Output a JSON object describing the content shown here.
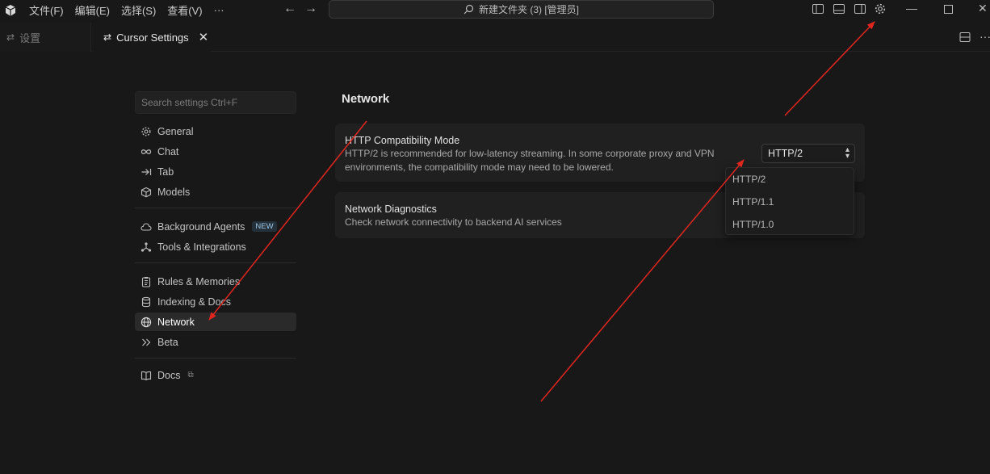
{
  "titlebar": {
    "menu": [
      "文件(F)",
      "编辑(E)",
      "选择(S)",
      "查看(V)",
      "···"
    ],
    "command_center": "新建文件夹 (3) [管理员]"
  },
  "tabs": {
    "inactive": "设置",
    "active": "Cursor Settings"
  },
  "sidebar": {
    "search_placeholder": "Search settings Ctrl+F",
    "items": [
      {
        "label": "General",
        "icon": "gear-icon"
      },
      {
        "label": "Chat",
        "icon": "infinity-icon"
      },
      {
        "label": "Tab",
        "icon": "tab-arrow-icon"
      },
      {
        "label": "Models",
        "icon": "cube-icon"
      },
      {
        "label": "Background Agents",
        "icon": "cloud-icon",
        "badge": "NEW"
      },
      {
        "label": "Tools & Integrations",
        "icon": "tools-icon"
      },
      {
        "label": "Rules & Memories",
        "icon": "clipboard-icon"
      },
      {
        "label": "Indexing & Docs",
        "icon": "database-icon"
      },
      {
        "label": "Network",
        "icon": "globe-icon",
        "active": true
      },
      {
        "label": "Beta",
        "icon": "chevrons-right-icon"
      },
      {
        "label": "Docs",
        "icon": "book-icon",
        "external": true
      }
    ]
  },
  "main": {
    "title": "Network",
    "http_mode": {
      "title": "HTTP Compatibility Mode",
      "description_line1": "HTTP/2 is recommended for low-latency streaming. In some corporate proxy and VPN",
      "description_line2": "environments, the compatibility mode may need to be lowered.",
      "selected": "HTTP/2",
      "options": [
        "HTTP/2",
        "HTTP/1.1",
        "HTTP/1.0"
      ]
    },
    "diagnostics": {
      "title": "Network Diagnostics",
      "description": "Check network connectivity to backend AI services"
    }
  },
  "colors": {
    "background": "#181818",
    "card": "#202020",
    "active_item": "#2a2a2a",
    "annotation_arrow": "#e0261f"
  }
}
